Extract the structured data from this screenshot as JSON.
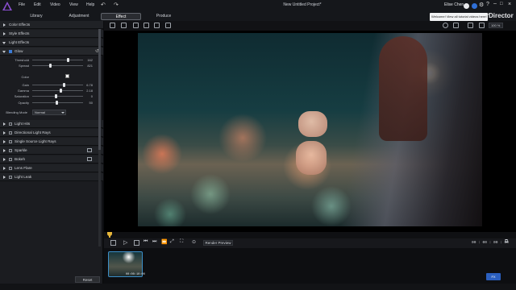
{
  "titlebar": {
    "menus": [
      "File",
      "Edit",
      "Video",
      "View",
      "Help"
    ],
    "doc_title": "New Untitled Project*",
    "user_name": "Elise Chen"
  },
  "tabs": [
    "Library",
    "Adjustment",
    "Effect",
    "Produce"
  ],
  "active_tab": "Effect",
  "tooltip": "Welcome! View all tutorial videos here!",
  "brand": "Director",
  "panel": {
    "sections": [
      "Color Effects",
      "Style Effects",
      "Light Effects"
    ],
    "glow": {
      "title": "Glow",
      "params": [
        {
          "label": "Threshold",
          "value": "162",
          "pos": 0.72
        },
        {
          "label": "Spread",
          "value": "821",
          "pos": 0.35
        },
        {
          "label": "Gain",
          "value": "6.78",
          "pos": 0.64
        },
        {
          "label": "Gamma",
          "value": "2.18",
          "pos": 0.56
        },
        {
          "label": "Saturation",
          "value": "0",
          "pos": 0.47
        },
        {
          "label": "Opacity",
          "value": "50",
          "pos": 0.48
        }
      ],
      "color_label": "Color",
      "blending_label": "Blending Mode",
      "blending_value": "Normal"
    },
    "effects_list": [
      "Light Hits",
      "Directional Light Rays",
      "Single Source Light Rays",
      "Sparkle",
      "Bokeh",
      "Lens Flare",
      "Light Leak"
    ],
    "reset_label": "Reset"
  },
  "preview": {
    "zoom": "100 %"
  },
  "transport": {
    "render_label": "Render Preview",
    "timecode": "00 : 00 : 00 : 00"
  },
  "clip": {
    "duration": "00:00:10:00"
  },
  "fx_badge": "FX"
}
